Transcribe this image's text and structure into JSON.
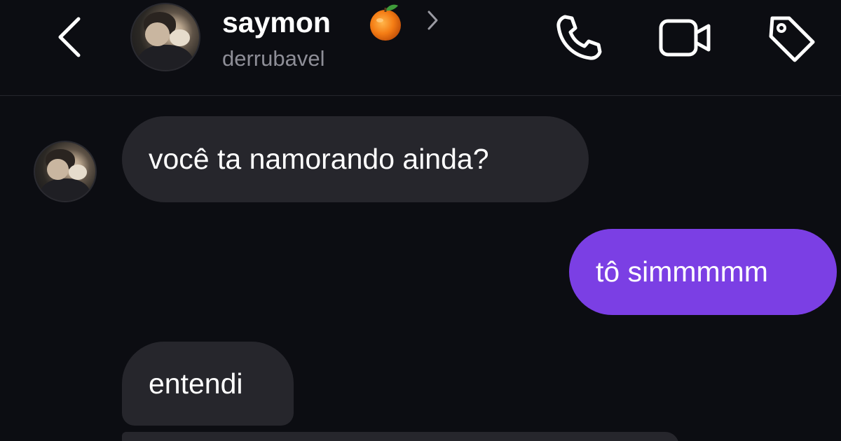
{
  "header": {
    "name": "saymon",
    "username": "derrubavel"
  },
  "icons": {
    "back": "chevron-left-icon",
    "name_emoji": "orange-icon",
    "name_chevron": "chevron-right-icon",
    "call": "phone-icon",
    "video": "video-camera-icon",
    "tag": "tag-icon"
  },
  "messages": [
    {
      "side": "received",
      "text": "você ta namorando ainda?"
    },
    {
      "side": "sent",
      "text": "tô simmmmm"
    },
    {
      "side": "received",
      "text": "entendi"
    },
    {
      "side": "received",
      "text": ""
    }
  ],
  "colors": {
    "background": "#0c0d12",
    "received_bubble": "#26262c",
    "sent_bubble": "#7b3fe4",
    "username": "#8e8e97"
  }
}
